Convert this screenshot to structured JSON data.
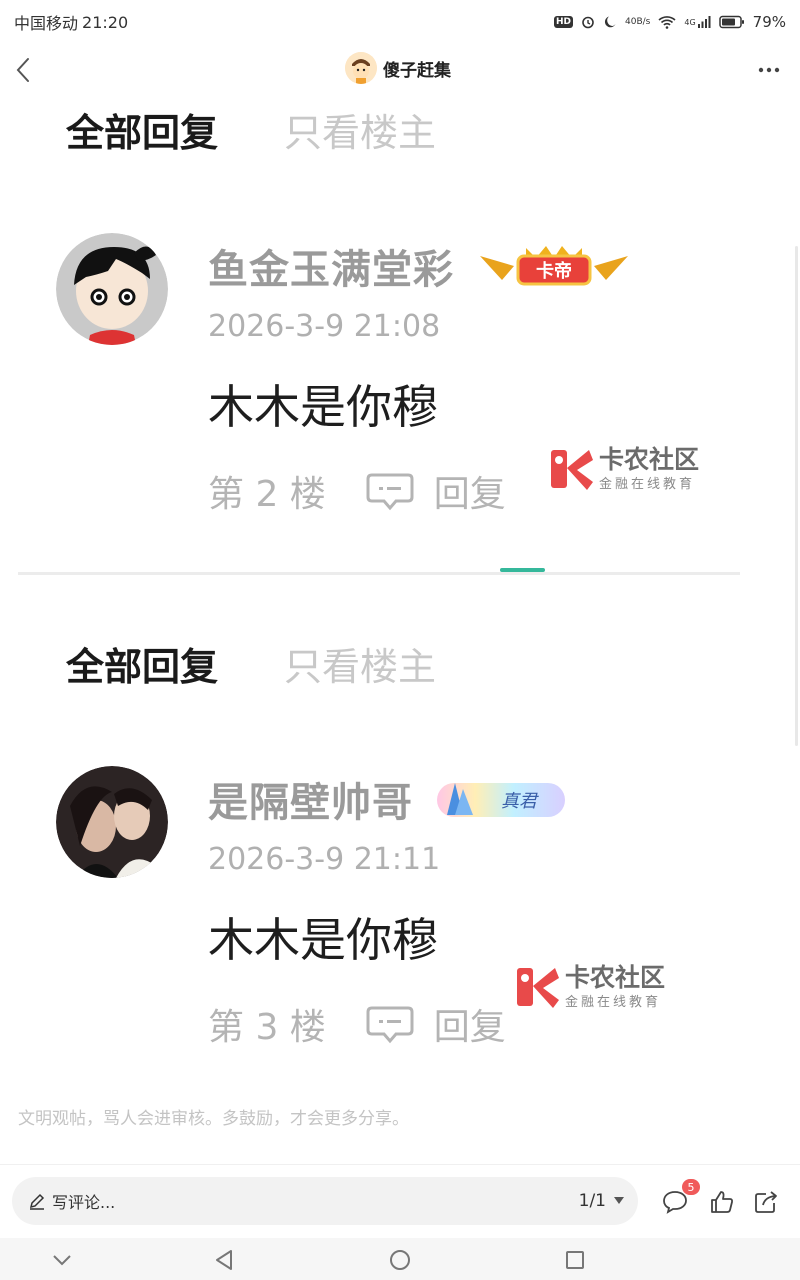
{
  "status_bar": {
    "carrier": "中国移动",
    "time": "21:20",
    "net_speed_value": "40",
    "net_speed_unit": "B/s",
    "signal_type": "4G",
    "battery": "79%"
  },
  "nav": {
    "title": "傻子赶集"
  },
  "tabs": {
    "all_replies": "全部回复",
    "op_only": "只看楼主"
  },
  "posts": [
    {
      "username": "鱼金玉满堂彩",
      "badge_text": "卡帝",
      "time": "2026-3-9 21:08",
      "body": "木木是你穆",
      "floor": "第 2 楼",
      "reply_label": "回复"
    },
    {
      "username": "是隔壁帅哥",
      "badge_text": "真君",
      "time": "2026-3-9 21:11",
      "body": "木木是你穆",
      "floor": "第 3 楼",
      "reply_label": "回复"
    }
  ],
  "watermark": {
    "main": "卡农社区",
    "sub": "金融在线教育"
  },
  "notice": "文明观帖，骂人会进审核。多鼓励，才会更多分享。",
  "bottom_bar": {
    "comment_placeholder": "写评论...",
    "page": "1/1",
    "comment_count": "5"
  },
  "colors": {
    "accent": "#35b89b",
    "badge_red": "#f05a5a",
    "tab_inactive": "#c8c8c8"
  }
}
